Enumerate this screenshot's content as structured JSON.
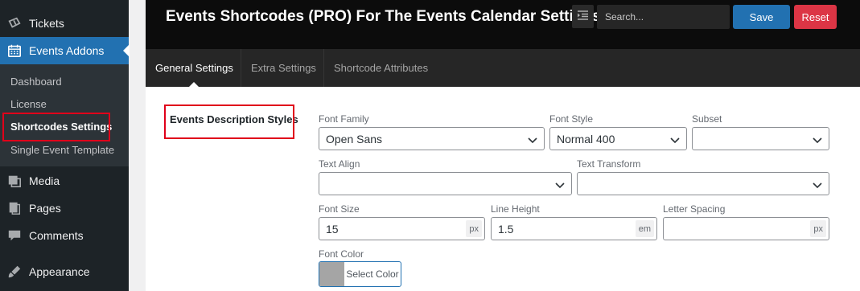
{
  "sidebar": {
    "menu": [
      {
        "label": "Tickets",
        "icon": "tickets-icon"
      },
      {
        "label": "Events Addons",
        "icon": "calendar-icon"
      },
      {
        "label": "Media",
        "icon": "media-icon"
      },
      {
        "label": "Pages",
        "icon": "pages-icon"
      },
      {
        "label": "Comments",
        "icon": "comments-icon"
      },
      {
        "label": "Appearance",
        "icon": "appearance-icon"
      }
    ],
    "submenu": [
      {
        "label": "Dashboard"
      },
      {
        "label": "License"
      },
      {
        "label": "Shortcodes Settings"
      },
      {
        "label": "Single Event Template"
      }
    ]
  },
  "header": {
    "title": "Events Shortcodes (PRO) For The Events Calendar Settings",
    "search_placeholder": "Search...",
    "save_label": "Save",
    "reset_label": "Reset"
  },
  "tabs": [
    {
      "label": "General Settings"
    },
    {
      "label": "Extra Settings"
    },
    {
      "label": "Shortcode Attributes"
    }
  ],
  "section": {
    "title": "Events Description Styles",
    "font_family": {
      "label": "Font Family",
      "value": "Open Sans"
    },
    "font_style": {
      "label": "Font Style",
      "value": "Normal 400"
    },
    "subset": {
      "label": "Subset",
      "value": ""
    },
    "text_align": {
      "label": "Text Align",
      "value": ""
    },
    "text_transform": {
      "label": "Text Transform",
      "value": ""
    },
    "font_size": {
      "label": "Font Size",
      "value": "15",
      "unit": "px"
    },
    "line_height": {
      "label": "Line Height",
      "value": "1.5",
      "unit": "em"
    },
    "letter_spacing": {
      "label": "Letter Spacing",
      "value": "",
      "unit": "px"
    },
    "font_color": {
      "label": "Font Color",
      "button_label": "Select Color"
    }
  },
  "colors": {
    "sidebar_bg": "#1d2327",
    "active_menu": "#2271b1",
    "save": "#2271b1",
    "reset": "#dc3545",
    "highlight": "#e0001a"
  }
}
